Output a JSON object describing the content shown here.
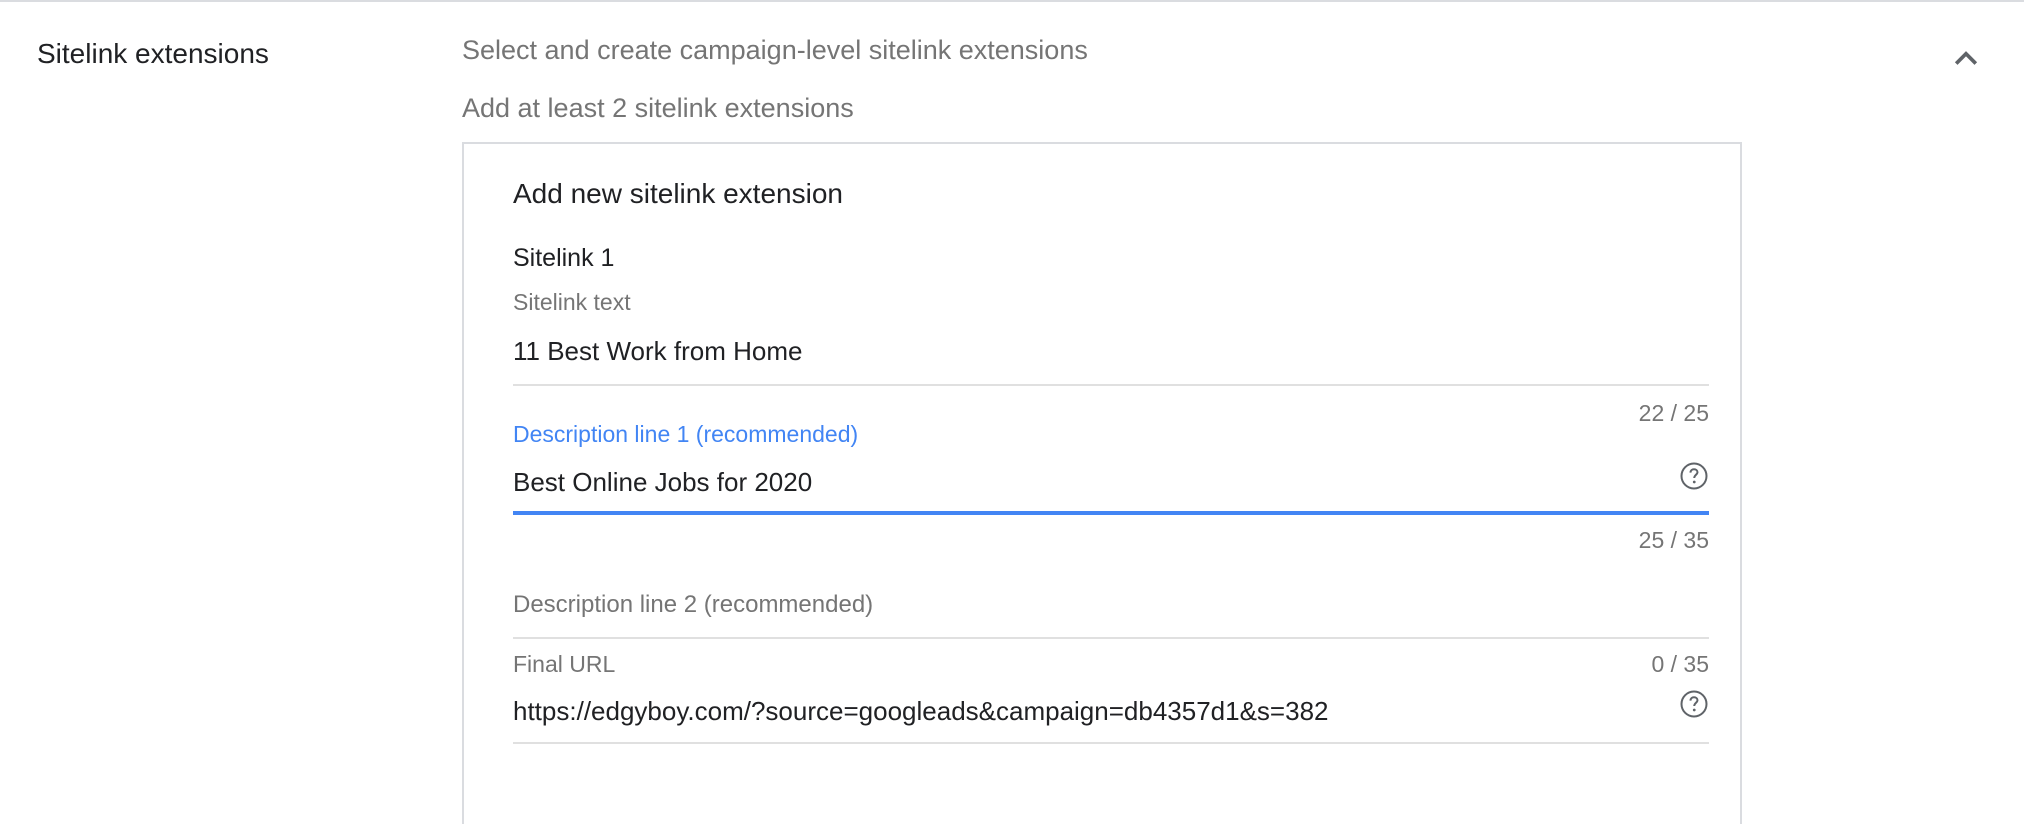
{
  "section": {
    "title": "Sitelink extensions",
    "subtitle": "Select and create campaign-level sitelink extensions",
    "hint": "Add at least 2 sitelink extensions",
    "collapse_icon": "chevron-up-icon"
  },
  "card": {
    "title": "Add new sitelink extension",
    "group_label": "Sitelink 1",
    "fields": {
      "sitelink_text": {
        "label": "Sitelink text",
        "value": "11 Best Work from Home",
        "counter": "22 / 25"
      },
      "description1": {
        "label": "Description line 1 (recommended)",
        "value": "Best Online Jobs for 2020",
        "counter": "25 / 35",
        "help_icon": "help-circle-icon"
      },
      "description2": {
        "label": "Description line 2 (recommended)",
        "value": "",
        "counter": "0 / 35"
      },
      "final_url": {
        "label": "Final URL",
        "value": "https://edgyboy.com/?source=googleads&campaign=db4357d1&s=382",
        "help_icon": "help-circle-icon"
      }
    }
  },
  "colors": {
    "accent": "#4285f4",
    "muted_text": "#757575",
    "divider": "#e0e0e0"
  }
}
